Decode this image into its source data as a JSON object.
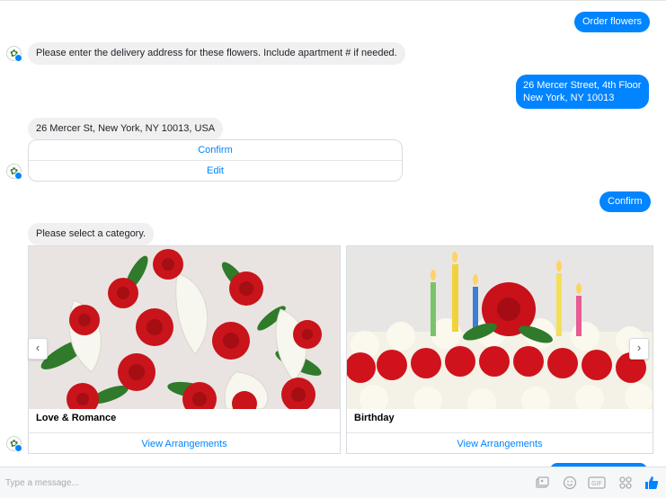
{
  "messages": {
    "order_flowers": "Order flowers",
    "address_prompt": "Please enter the delivery address for these flowers. Include apartment # if needed.",
    "user_address_line1": "26 Mercer Street, 4th Floor",
    "user_address_line2": "New York, NY 10013",
    "parsed_address": "26 Mercer St, New York, NY 10013, USA",
    "confirm_option": "Confirm",
    "edit_option": "Edit",
    "user_confirm": "Confirm",
    "category_prompt": "Please select a category."
  },
  "cards": [
    {
      "title": "Love & Romance",
      "action": "View Arrangements"
    },
    {
      "title": "Birthday",
      "action": "View Arrangements"
    }
  ],
  "carousel": {
    "prev_icon": "‹",
    "next_icon": "›"
  },
  "composer": {
    "placeholder": "Type a message...",
    "icons": [
      "photo-icon",
      "emoji-icon",
      "gif-icon",
      "apps-icon",
      "like-icon"
    ]
  },
  "colors": {
    "accent": "#0084ff",
    "incoming_bubble": "#f1f0f0"
  }
}
